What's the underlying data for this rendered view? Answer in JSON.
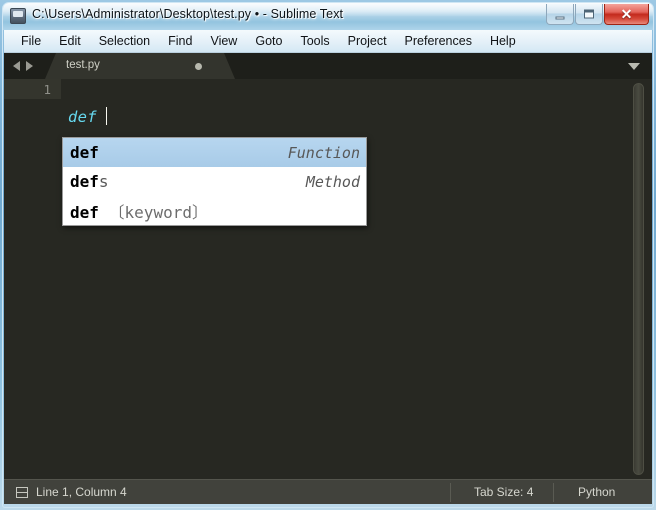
{
  "window": {
    "title": "C:\\Users\\Administrator\\Desktop\\test.py • - Sublime Text",
    "app_icon": "sublime-text-icon",
    "controls": {
      "minimize": "–",
      "maximize": "□",
      "close": "✕"
    }
  },
  "menubar": {
    "items": [
      {
        "label": "File"
      },
      {
        "label": "Edit"
      },
      {
        "label": "Selection"
      },
      {
        "label": "Find"
      },
      {
        "label": "View"
      },
      {
        "label": "Goto"
      },
      {
        "label": "Tools"
      },
      {
        "label": "Project"
      },
      {
        "label": "Preferences"
      },
      {
        "label": "Help"
      }
    ]
  },
  "tabbar": {
    "nav_prev_icon": "chevron-left-icon",
    "nav_next_icon": "chevron-right-icon",
    "menu_icon": "chevron-down-icon",
    "tabs": [
      {
        "label": "test.py",
        "modified": true,
        "active": true
      }
    ]
  },
  "editor": {
    "line_number": "1",
    "code": "def",
    "syntax_color": "#66d9ef",
    "background": "#272822",
    "caret_visible": true
  },
  "autocomplete": {
    "rows": [
      {
        "match": "def",
        "rest": "",
        "keyword": "",
        "type": "Function",
        "selected": true
      },
      {
        "match": "def",
        "rest": "s",
        "keyword": "",
        "type": "Method",
        "selected": false
      },
      {
        "match": "def",
        "rest": "",
        "keyword": " 〔keyword〕",
        "type": "",
        "selected": false
      }
    ],
    "selection_color": "#a8cbe8"
  },
  "statusbar": {
    "panel_icon": "sidebar-toggle-icon",
    "position": "Line 1, Column 4",
    "tab_size": "Tab Size: 4",
    "syntax": "Python"
  }
}
